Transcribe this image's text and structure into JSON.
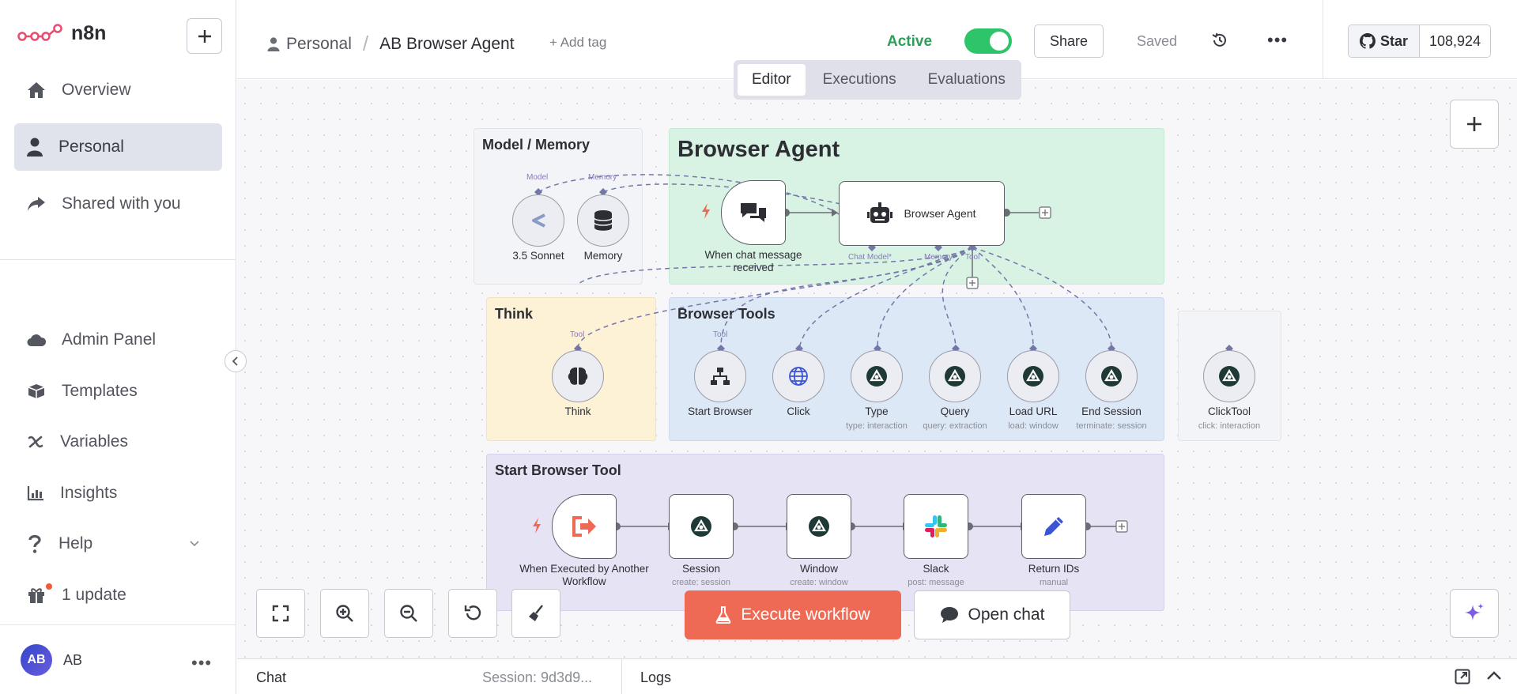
{
  "app": {
    "name": "n8n"
  },
  "sidebar": {
    "items_top": [
      {
        "label": "Overview",
        "icon": "home-icon"
      },
      {
        "label": "Personal",
        "icon": "user-icon",
        "active": true
      },
      {
        "label": "Shared with you",
        "icon": "share-icon"
      }
    ],
    "items_bottom": [
      {
        "label": "Admin Panel",
        "icon": "cloud-icon"
      },
      {
        "label": "Templates",
        "icon": "box-icon"
      },
      {
        "label": "Variables",
        "icon": "variable-icon"
      },
      {
        "label": "Insights",
        "icon": "chart-icon"
      },
      {
        "label": "Help",
        "icon": "question-icon"
      },
      {
        "label": "1 update",
        "icon": "gift-icon"
      }
    ],
    "user": {
      "initials": "AB",
      "name": "AB"
    }
  },
  "header": {
    "breadcrumb_project": "Personal",
    "workflow_name": "AB Browser Agent",
    "add_tag": "+ Add tag",
    "active_label": "Active",
    "active": true,
    "share_label": "Share",
    "saved_label": "Saved",
    "github_star": "Star",
    "github_count": "108,924",
    "tabs": [
      "Editor",
      "Executions",
      "Evaluations"
    ],
    "active_tab": "Editor"
  },
  "canvas": {
    "notes": {
      "model_memory": "Model / Memory",
      "browser_agent": "Browser Agent",
      "think": "Think",
      "browser_tools": "Browser Tools",
      "start_browser_tool": "Start Browser Tool"
    },
    "nodes": {
      "sonnet": {
        "label": "3.5 Sonnet",
        "port": "Model"
      },
      "memory": {
        "label": "Memory",
        "port": "Memory"
      },
      "chat_trigger": {
        "label": "When chat message received"
      },
      "agent": {
        "label": "Browser Agent",
        "ports": [
          "Chat Model*",
          "Memory",
          "Tool"
        ]
      },
      "think": {
        "label": "Think",
        "port": "Tool"
      },
      "start_browser": {
        "label": "Start Browser",
        "port": "Tool"
      },
      "click": {
        "label": "Click"
      },
      "type": {
        "label": "Type",
        "sub": "type: interaction"
      },
      "query": {
        "label": "Query",
        "sub": "query: extraction"
      },
      "load_url": {
        "label": "Load URL",
        "sub": "load: window"
      },
      "end_session": {
        "label": "End Session",
        "sub": "terminate: session"
      },
      "click_tool": {
        "label": "ClickTool",
        "sub": "click: interaction"
      },
      "exec_trigger": {
        "label": "When Executed by Another Workflow"
      },
      "session": {
        "label": "Session",
        "sub": "create: session"
      },
      "window": {
        "label": "Window",
        "sub": "create: window"
      },
      "slack": {
        "label": "Slack",
        "sub": "post: message"
      },
      "return_ids": {
        "label": "Return IDs",
        "sub": "manual"
      }
    },
    "execute_label": "Execute workflow",
    "open_chat_label": "Open chat"
  },
  "bottombar": {
    "chat": "Chat",
    "session": "Session: 9d3d9...",
    "logs": "Logs"
  },
  "colors": {
    "accent": "#ef6a55",
    "active_green": "#2ec56a",
    "note_green": "#d8f3e4",
    "note_blue": "#dde8f7",
    "note_yellow": "#fdf1d6",
    "note_purple": "#e6e3f5",
    "note_gray": "#f3f4f7"
  }
}
